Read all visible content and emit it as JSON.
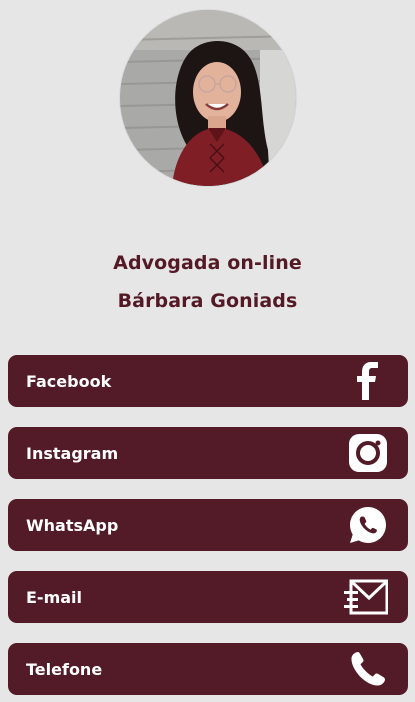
{
  "profile": {
    "avatar_icon": "profile-photo",
    "title": "Advogada on-line",
    "name": "Bárbara Goniads"
  },
  "links": [
    {
      "label": "Facebook",
      "icon": "facebook-icon"
    },
    {
      "label": "Instagram",
      "icon": "instagram-icon"
    },
    {
      "label": "WhatsApp",
      "icon": "whatsapp-icon"
    },
    {
      "label": "E-mail",
      "icon": "email-icon"
    },
    {
      "label": "Telefone",
      "icon": "phone-icon"
    }
  ],
  "colors": {
    "background": "#e6e6e6",
    "accent": "#521b27",
    "text_on_accent": "#ffffff"
  }
}
